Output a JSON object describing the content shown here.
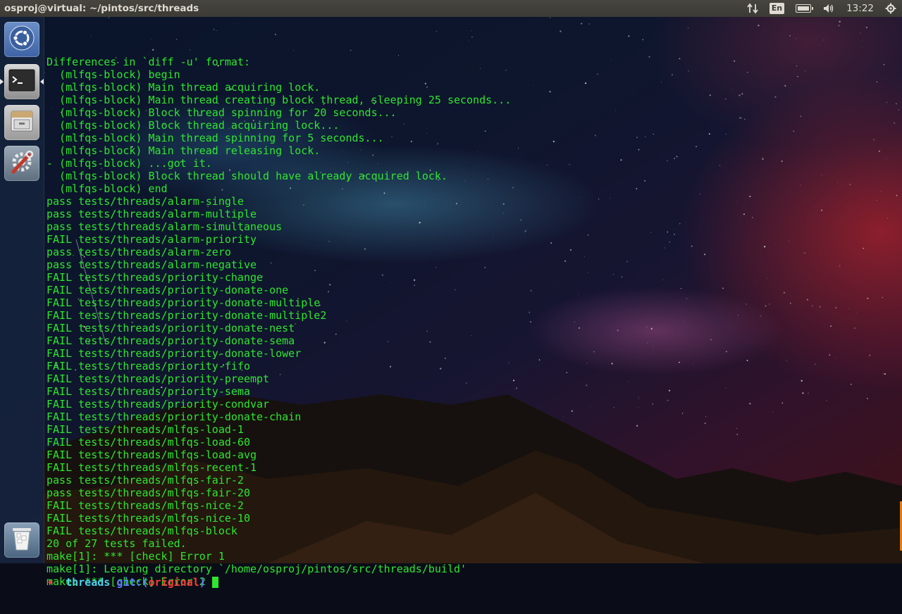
{
  "window": {
    "title": "osproj@virtual: ~/pintos/src/threads"
  },
  "top_panel": {
    "network_icon": "network-updown-icon",
    "keyboard_layout": "En",
    "battery_icon": "battery-icon",
    "volume_icon": "volume-icon",
    "clock": "13:22",
    "power_icon": "gear-power-icon"
  },
  "launcher": {
    "items": [
      {
        "name": "Dash Home",
        "icon": "ubuntu-logo-icon"
      },
      {
        "name": "Terminal",
        "icon": "terminal-icon",
        "active": true
      },
      {
        "name": "Files",
        "icon": "file-cabinet-icon"
      },
      {
        "name": "System Settings",
        "icon": "wrench-gear-icon"
      },
      {
        "name": "Trash",
        "icon": "trash-icon"
      }
    ]
  },
  "terminal": {
    "lines": [
      "Differences in `diff -u' format:",
      "  (mlfqs-block) begin",
      "  (mlfqs-block) Main thread acquiring lock.",
      "  (mlfqs-block) Main thread creating block thread, sleeping 25 seconds...",
      "  (mlfqs-block) Block thread spinning for 20 seconds...",
      "  (mlfqs-block) Block thread acquiring lock...",
      "  (mlfqs-block) Main thread spinning for 5 seconds...",
      "  (mlfqs-block) Main thread releasing lock.",
      "- (mlfqs-block) ...got it.",
      "  (mlfqs-block) Block thread should have already acquired lock.",
      "  (mlfqs-block) end",
      "pass tests/threads/alarm-single",
      "pass tests/threads/alarm-multiple",
      "pass tests/threads/alarm-simultaneous",
      "FAIL tests/threads/alarm-priority",
      "pass tests/threads/alarm-zero",
      "pass tests/threads/alarm-negative",
      "FAIL tests/threads/priority-change",
      "FAIL tests/threads/priority-donate-one",
      "FAIL tests/threads/priority-donate-multiple",
      "FAIL tests/threads/priority-donate-multiple2",
      "FAIL tests/threads/priority-donate-nest",
      "FAIL tests/threads/priority-donate-sema",
      "FAIL tests/threads/priority-donate-lower",
      "FAIL tests/threads/priority-fifo",
      "FAIL tests/threads/priority-preempt",
      "FAIL tests/threads/priority-sema",
      "FAIL tests/threads/priority-condvar",
      "FAIL tests/threads/priority-donate-chain",
      "FAIL tests/threads/mlfqs-load-1",
      "FAIL tests/threads/mlfqs-load-60",
      "FAIL tests/threads/mlfqs-load-avg",
      "FAIL tests/threads/mlfqs-recent-1",
      "pass tests/threads/mlfqs-fair-2",
      "pass tests/threads/mlfqs-fair-20",
      "FAIL tests/threads/mlfqs-nice-2",
      "FAIL tests/threads/mlfqs-nice-10",
      "FAIL tests/threads/mlfqs-block",
      "20 of 27 tests failed.",
      "make[1]: *** [check] Error 1",
      "make[1]: Leaving directory `/home/osproj/pintos/src/threads/build'",
      "make: *** [check] Error 2"
    ],
    "prompt": {
      "arrow": "➜",
      "dir": "threads",
      "git_label": "git:(",
      "branch": "original",
      "git_close": ")"
    },
    "colors": {
      "text": "#2ee62e",
      "prompt_arrow": "#ff3a3a",
      "prompt_dir": "#4fd2e8",
      "prompt_git": "#5c7cff",
      "prompt_branch": "#ff3a3a"
    }
  }
}
